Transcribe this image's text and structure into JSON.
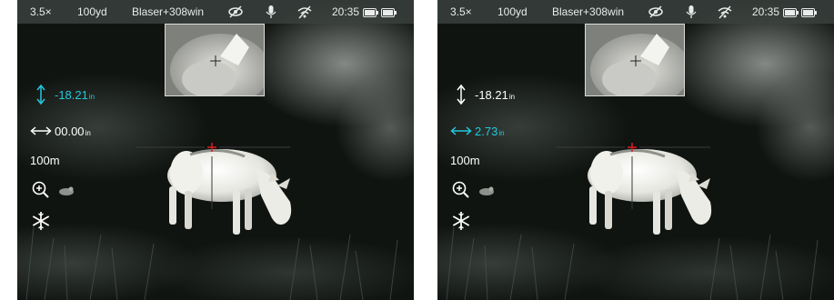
{
  "screens": [
    {
      "status": {
        "zoom": "3.5×",
        "distance": "100yd",
        "profile": "Blaser+308win",
        "time": "20:35"
      },
      "vertical": {
        "value": "-18.21",
        "unit": "in",
        "active": true
      },
      "horizontal": {
        "value": "00.00",
        "unit": "in",
        "active": false
      },
      "range": "100m",
      "icons": [
        "eye-off-icon",
        "microphone-icon",
        "wifi-off-icon",
        "battery-icon",
        "battery-icon",
        "zoom-in-icon",
        "target-icon",
        "freeze-icon"
      ]
    },
    {
      "status": {
        "zoom": "3.5×",
        "distance": "100yd",
        "profile": "Blaser+308win",
        "time": "20:35"
      },
      "vertical": {
        "value": "-18.21",
        "unit": "in",
        "active": false
      },
      "horizontal": {
        "value": "2.73",
        "unit": "in",
        "active": true
      },
      "range": "100m",
      "icons": [
        "eye-off-icon",
        "microphone-icon",
        "wifi-off-icon",
        "battery-icon",
        "battery-icon",
        "zoom-in-icon",
        "target-icon",
        "freeze-icon"
      ]
    }
  ],
  "colors": {
    "accent": "#22c8dc",
    "reticle": "#e01b24",
    "text": "#ffffff"
  }
}
